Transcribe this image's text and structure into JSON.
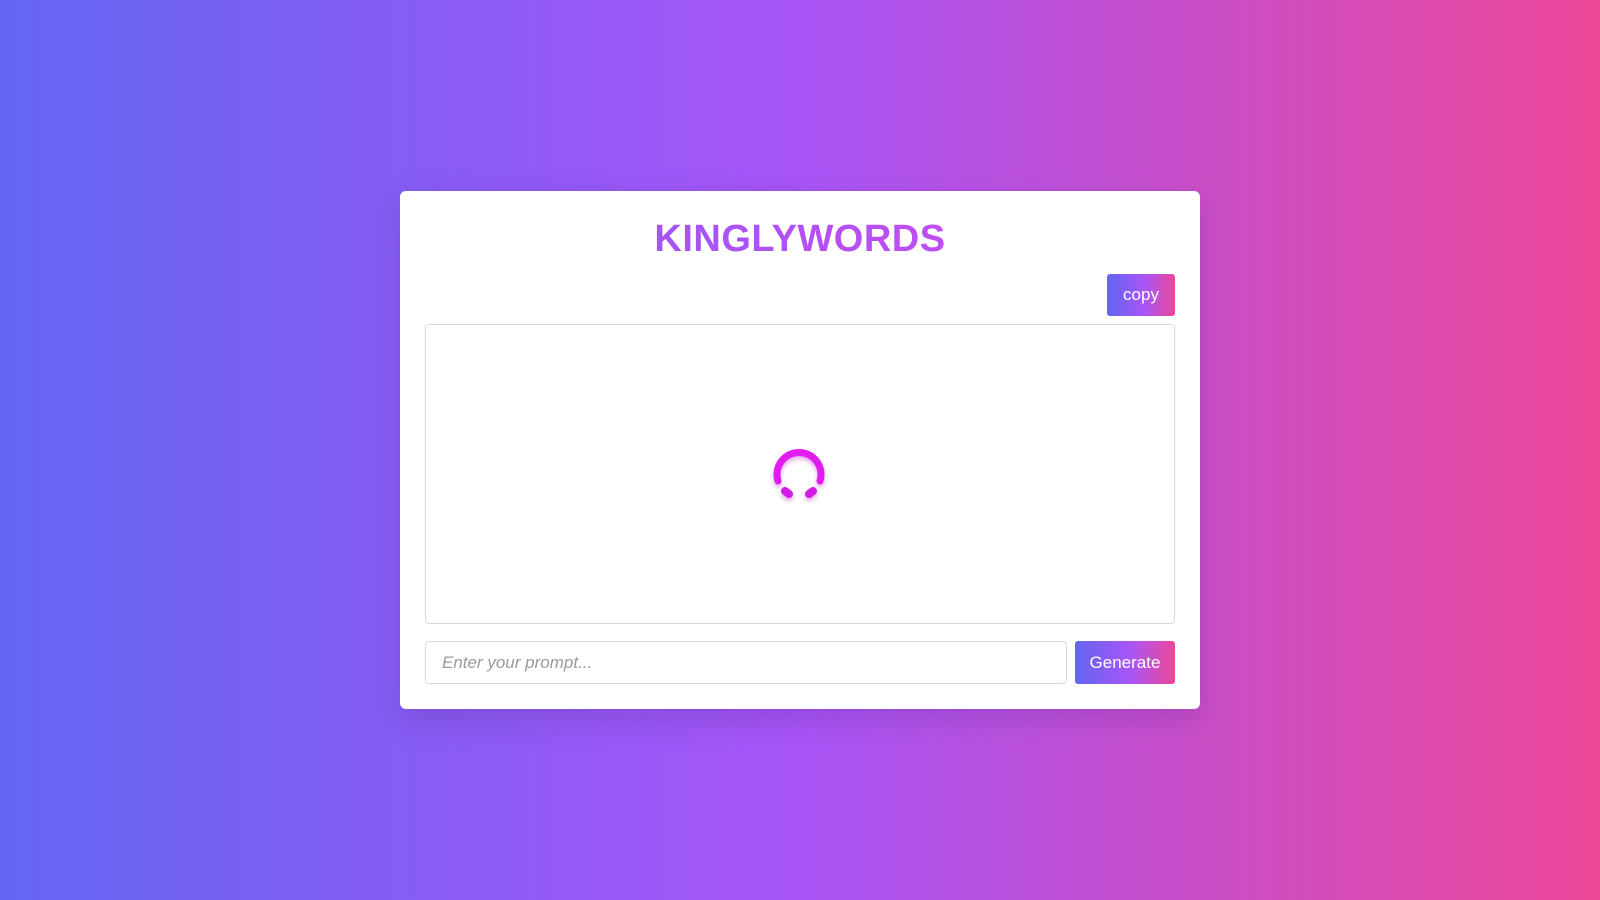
{
  "app": {
    "title": "KINGLYWORDS"
  },
  "toolbar": {
    "copy_label": "copy"
  },
  "output": {
    "state": "loading",
    "spinner_icon": "loading-spinner-icon",
    "text": ""
  },
  "prompt": {
    "placeholder": "Enter your prompt...",
    "value": "",
    "generate_label": "Generate"
  },
  "colors": {
    "gradient_start": "#6366f1",
    "gradient_mid": "#a855f7",
    "gradient_end": "#ec4899",
    "spinner": "#e11df0",
    "card_background": "#ffffff"
  }
}
